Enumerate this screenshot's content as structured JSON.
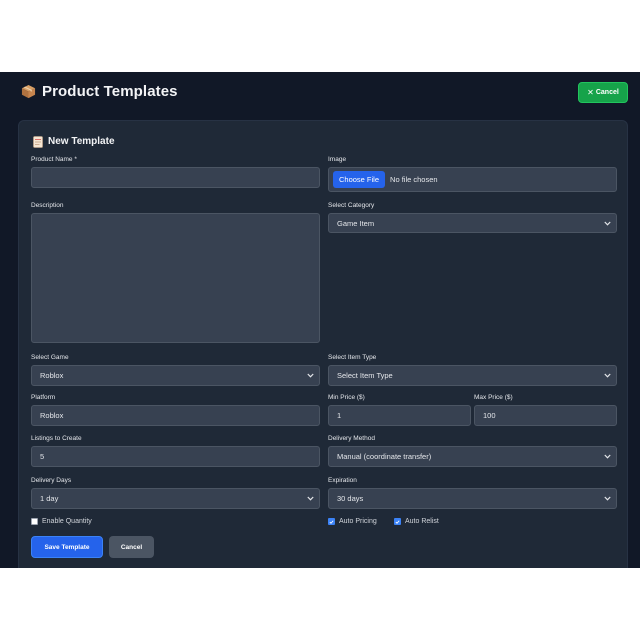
{
  "header": {
    "title": "Product Templates",
    "cancel_label": "Cancel",
    "cancel_color": "#16a34a"
  },
  "panel": {
    "title": "New Template"
  },
  "form": {
    "product_name": {
      "label": "Product Name *",
      "value": ""
    },
    "image": {
      "label": "Image",
      "button_label": "Choose File",
      "status": "No file chosen"
    },
    "description": {
      "label": "Description",
      "value": ""
    },
    "category": {
      "label": "Select Category",
      "value": "Game Item"
    },
    "game": {
      "label": "Select Game",
      "value": "Roblox"
    },
    "item_type": {
      "label": "Select Item Type",
      "value": "Select Item Type"
    },
    "platform": {
      "label": "Platform",
      "value": "Roblox"
    },
    "min_price": {
      "label": "Min Price ($)",
      "value": "1"
    },
    "max_price": {
      "label": "Max Price ($)",
      "value": "100"
    },
    "listings": {
      "label": "Listings to Create",
      "value": "5"
    },
    "delivery_method": {
      "label": "Delivery Method",
      "value": "Manual (coordinate transfer)"
    },
    "delivery_days": {
      "label": "Delivery Days",
      "value": "1 day"
    },
    "expiration": {
      "label": "Expiration",
      "value": "30 days"
    },
    "enable_quantity": {
      "label": "Enable Quantity",
      "checked": false
    },
    "auto_pricing": {
      "label": "Auto Pricing",
      "checked": true
    },
    "auto_relist": {
      "label": "Auto Relist",
      "checked": true
    }
  },
  "actions": {
    "save_label": "Save Template",
    "cancel_label": "Cancel"
  },
  "icons": {
    "title_icon": "package-icon",
    "panel_icon": "memo-icon"
  },
  "colors": {
    "background": "#111827",
    "panel": "#1f2937",
    "field": "#374151",
    "primary": "#2563eb"
  }
}
